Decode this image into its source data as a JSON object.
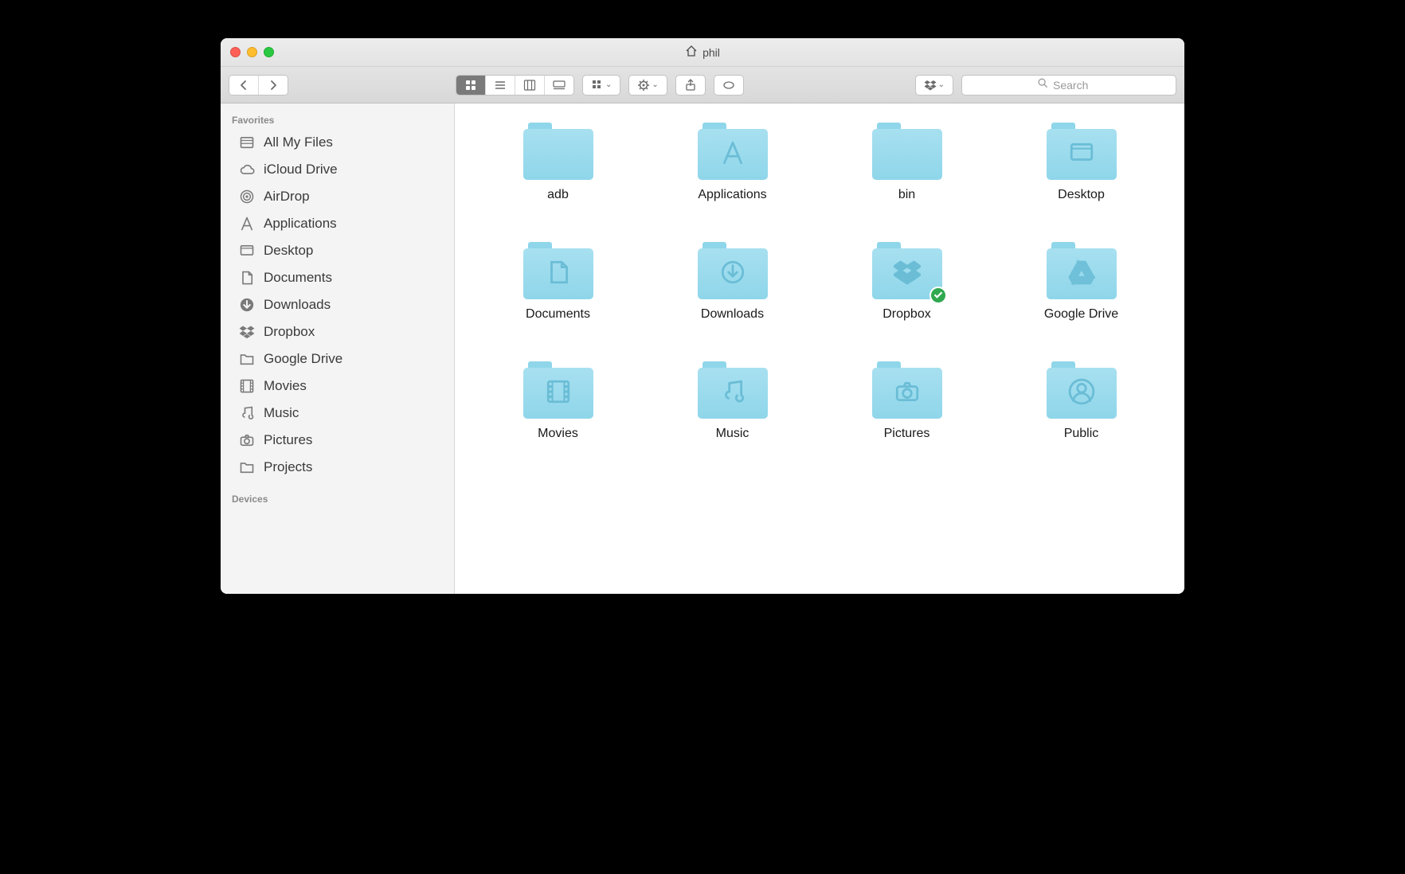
{
  "window": {
    "title": "phil"
  },
  "search": {
    "placeholder": "Search"
  },
  "sidebar": {
    "sections": {
      "favorites_label": "Favorites",
      "devices_label": "Devices"
    },
    "favorites": [
      {
        "label": "All My Files",
        "icon": "all-my-files"
      },
      {
        "label": "iCloud Drive",
        "icon": "cloud"
      },
      {
        "label": "AirDrop",
        "icon": "airdrop"
      },
      {
        "label": "Applications",
        "icon": "applications"
      },
      {
        "label": "Desktop",
        "icon": "desktop"
      },
      {
        "label": "Documents",
        "icon": "documents"
      },
      {
        "label": "Downloads",
        "icon": "downloads"
      },
      {
        "label": "Dropbox",
        "icon": "dropbox"
      },
      {
        "label": "Google Drive",
        "icon": "folder"
      },
      {
        "label": "Movies",
        "icon": "movies"
      },
      {
        "label": "Music",
        "icon": "music"
      },
      {
        "label": "Pictures",
        "icon": "pictures"
      },
      {
        "label": "Projects",
        "icon": "folder"
      }
    ]
  },
  "folders": [
    {
      "label": "adb",
      "glyph": ""
    },
    {
      "label": "Applications",
      "glyph": "applications"
    },
    {
      "label": "bin",
      "glyph": ""
    },
    {
      "label": "Desktop",
      "glyph": "desktop"
    },
    {
      "label": "Documents",
      "glyph": "documents"
    },
    {
      "label": "Downloads",
      "glyph": "downloads"
    },
    {
      "label": "Dropbox",
      "glyph": "dropbox",
      "synced": true
    },
    {
      "label": "Google Drive",
      "glyph": "gdrive"
    },
    {
      "label": "Movies",
      "glyph": "movies"
    },
    {
      "label": "Music",
      "glyph": "music"
    },
    {
      "label": "Pictures",
      "glyph": "pictures"
    },
    {
      "label": "Public",
      "glyph": "public"
    }
  ]
}
